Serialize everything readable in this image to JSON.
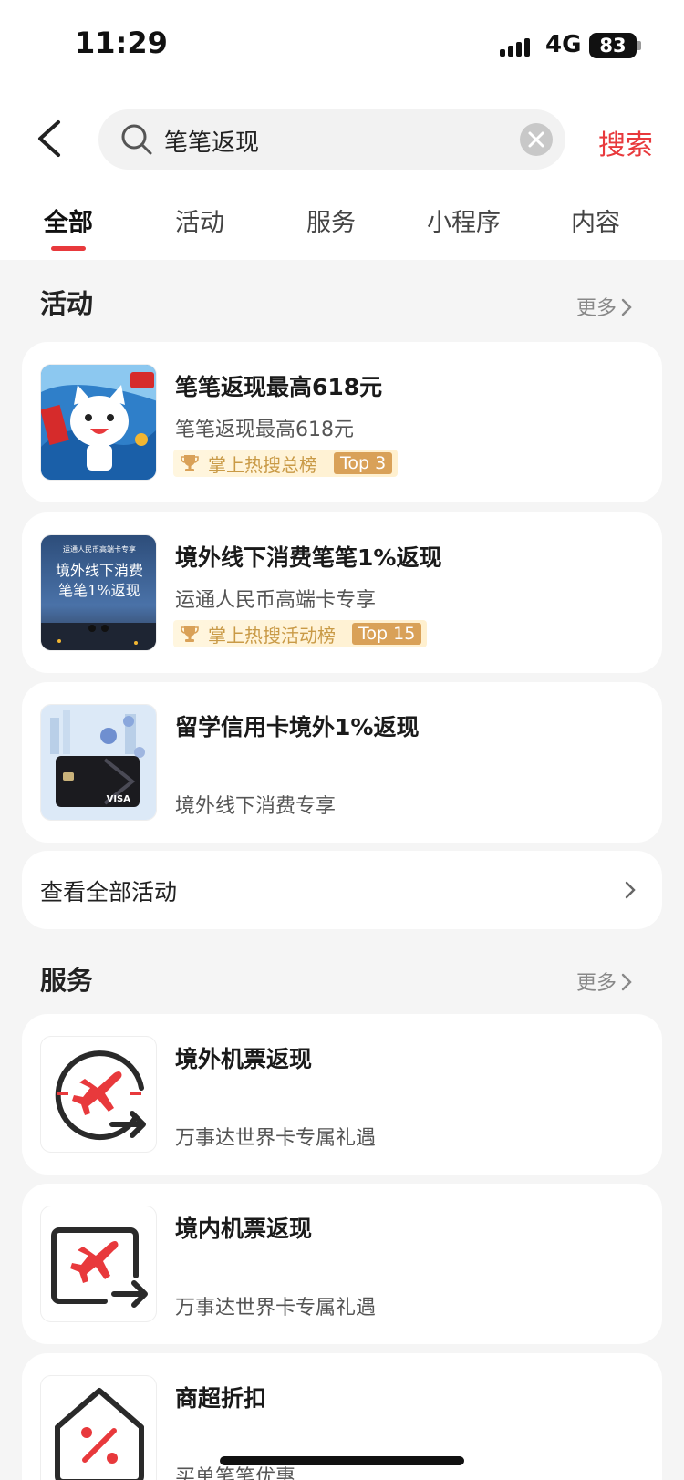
{
  "status_bar": {
    "time": "11:29",
    "network": "4G",
    "battery": "83"
  },
  "search": {
    "query": "笔笔返现",
    "button": "搜索"
  },
  "tabs": [
    {
      "label": "全部",
      "active": true
    },
    {
      "label": "活动",
      "active": false
    },
    {
      "label": "服务",
      "active": false
    },
    {
      "label": "小程序",
      "active": false
    },
    {
      "label": "内容",
      "active": false
    }
  ],
  "activities_section": {
    "title": "活动",
    "more": "更多",
    "items": [
      {
        "title": "笔笔返现最高618元",
        "subtitle": "笔笔返现最高618元",
        "rank_text": "掌上热搜总榜",
        "rank_badge": "Top 3",
        "thumb_icon": "cat-mascot-promo-image"
      },
      {
        "title": "境外线下消费笔笔1%返现",
        "subtitle": "运通人民币高端卡专享",
        "rank_text": "掌上热搜活动榜",
        "rank_badge": "Top 15",
        "thumb_icon": "overseas-cashback-banner-image",
        "thumb_text_1": "运通人民币高端卡专享",
        "thumb_text_2": "境外线下消费",
        "thumb_text_3": "笔笔1%返现"
      },
      {
        "title": "留学信用卡境外1%返现",
        "subtitle": "境外线下消费专享",
        "thumb_icon": "visa-card-image",
        "thumb_text_1": "VISA"
      }
    ],
    "view_all": "查看全部活动"
  },
  "services_section": {
    "title": "服务",
    "more": "更多",
    "items": [
      {
        "title": "境外机票返现",
        "subtitle": "万事达世界卡专属礼遇",
        "icon": "overseas-flight-icon"
      },
      {
        "title": "境内机票返现",
        "subtitle": "万事达世界卡专属礼遇",
        "icon": "domestic-flight-icon"
      },
      {
        "title": "商超折扣",
        "subtitle": "买单笔笔优惠",
        "icon": "store-discount-icon"
      }
    ]
  },
  "colors": {
    "accent": "#e8393c",
    "rank_gold": "#d9a158",
    "background": "#f5f5f5"
  }
}
